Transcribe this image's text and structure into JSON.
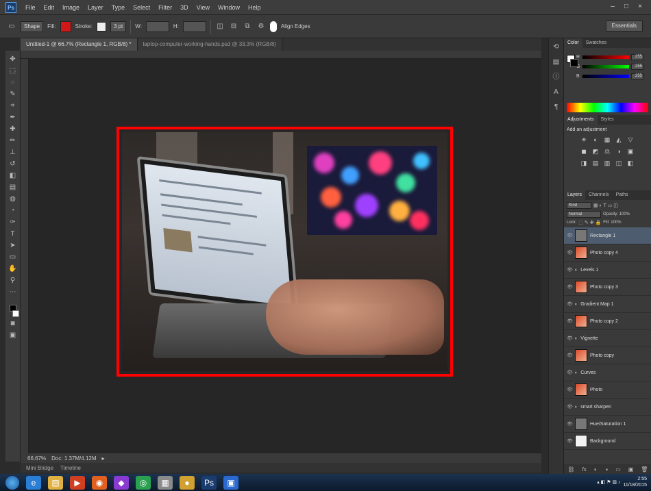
{
  "app": {
    "logo": "Ps"
  },
  "menu": {
    "items": [
      "File",
      "Edit",
      "Image",
      "Layer",
      "Type",
      "Select",
      "Filter",
      "3D",
      "View",
      "Window",
      "Help"
    ]
  },
  "window_buttons": {
    "minimize": "–",
    "maximize": "□",
    "close": "×"
  },
  "options_bar": {
    "preset": "Shape",
    "fill_label": "Fill:",
    "stroke_label": "Stroke:",
    "stroke_width": "3 pt",
    "w_label": "W:",
    "h_label": "H:",
    "align_edges": "Align Edges",
    "workspace": "Essentials",
    "colors": {
      "fill": "#d01818",
      "stroke": "#eeeeee"
    }
  },
  "document": {
    "tabs": [
      {
        "label": "Untitled-1 @ 66.7% (Rectangle 1, RGB/8) *",
        "active": true
      },
      {
        "label": "laptop-computer-working-hands.psd @ 33.3% (RGB/8)",
        "active": false
      }
    ],
    "selection_color": "#ff0000"
  },
  "status": {
    "zoom": "66.67%",
    "doc_info": "Doc: 1.37M/4.12M"
  },
  "bottom_tabs": [
    "Mini Bridge",
    "Timeline"
  ],
  "right_panel": {
    "color_tabs": [
      "Color",
      "Swatches"
    ],
    "sliders": [
      {
        "label": "R",
        "value": "255",
        "gradient": "linear-gradient(90deg,#000,#f00)"
      },
      {
        "label": "G",
        "value": "255",
        "gradient": "linear-gradient(90deg,#000,#0f0)"
      },
      {
        "label": "B",
        "value": "255",
        "gradient": "linear-gradient(90deg,#000,#00f)"
      }
    ],
    "adjust_tabs": [
      "Adjustments",
      "Styles"
    ],
    "adjust_title": "Add an adjustment",
    "adjust_icons": [
      "☀",
      "◐",
      "▦",
      "◭",
      "▽",
      "◼",
      "◩",
      "⚖",
      "◑",
      "▣",
      "◨",
      "▤",
      "▥",
      "◫",
      "◧"
    ],
    "layer_tabs": [
      "Layers",
      "Channels",
      "Paths"
    ],
    "kind_label": "Kind",
    "blend_mode": "Normal",
    "opacity_label": "Opacity: 100%",
    "lock_label": "Lock:",
    "fill_label": "Fill: 100%",
    "layers": [
      {
        "name": "Rectangle 1",
        "thumb": "adj",
        "selected": true
      },
      {
        "name": "Photo copy 4",
        "thumb": "photo",
        "selected": false
      },
      {
        "name": "Levels 1",
        "thumb": "none",
        "selected": false
      },
      {
        "name": "Photo copy 3",
        "thumb": "photo",
        "selected": false
      },
      {
        "name": "Gradient Map 1",
        "thumb": "none",
        "selected": false
      },
      {
        "name": "Photo copy 2",
        "thumb": "photo",
        "selected": false
      },
      {
        "name": "Vignette",
        "thumb": "none",
        "selected": false
      },
      {
        "name": "Photo copy",
        "thumb": "photo",
        "selected": false
      },
      {
        "name": "Curves",
        "thumb": "none",
        "selected": false
      },
      {
        "name": "Photo",
        "thumb": "photo",
        "selected": false
      },
      {
        "name": "smart sharpen",
        "thumb": "none",
        "selected": false
      },
      {
        "name": "Hue/Saturation 1",
        "thumb": "adj",
        "selected": false
      },
      {
        "name": "Background",
        "thumb": "white",
        "selected": false
      }
    ],
    "footer_icons": [
      "⛓",
      "fx",
      "◐",
      "◑",
      "▭",
      "▣",
      "🗑"
    ]
  },
  "taskbar": {
    "apps": [
      {
        "name": "explorer",
        "glyph": "e",
        "color": "#2a7fd4"
      },
      {
        "name": "folder",
        "glyph": "▤",
        "color": "#e0b040"
      },
      {
        "name": "media",
        "glyph": "▶",
        "color": "#d04020"
      },
      {
        "name": "browser",
        "glyph": "◉",
        "color": "#e06020"
      },
      {
        "name": "app5",
        "glyph": "◆",
        "color": "#8a3ad0"
      },
      {
        "name": "chrome",
        "glyph": "◎",
        "color": "#2aa050"
      },
      {
        "name": "app7",
        "glyph": "▦",
        "color": "#8a8a8a"
      },
      {
        "name": "app8",
        "glyph": "●",
        "color": "#d0a030"
      },
      {
        "name": "photoshop",
        "glyph": "Ps",
        "color": "#1a3c6e"
      },
      {
        "name": "app10",
        "glyph": "▣",
        "color": "#2a6ad0"
      }
    ],
    "clock_time": "2:55",
    "clock_date": "11/18/2015"
  }
}
